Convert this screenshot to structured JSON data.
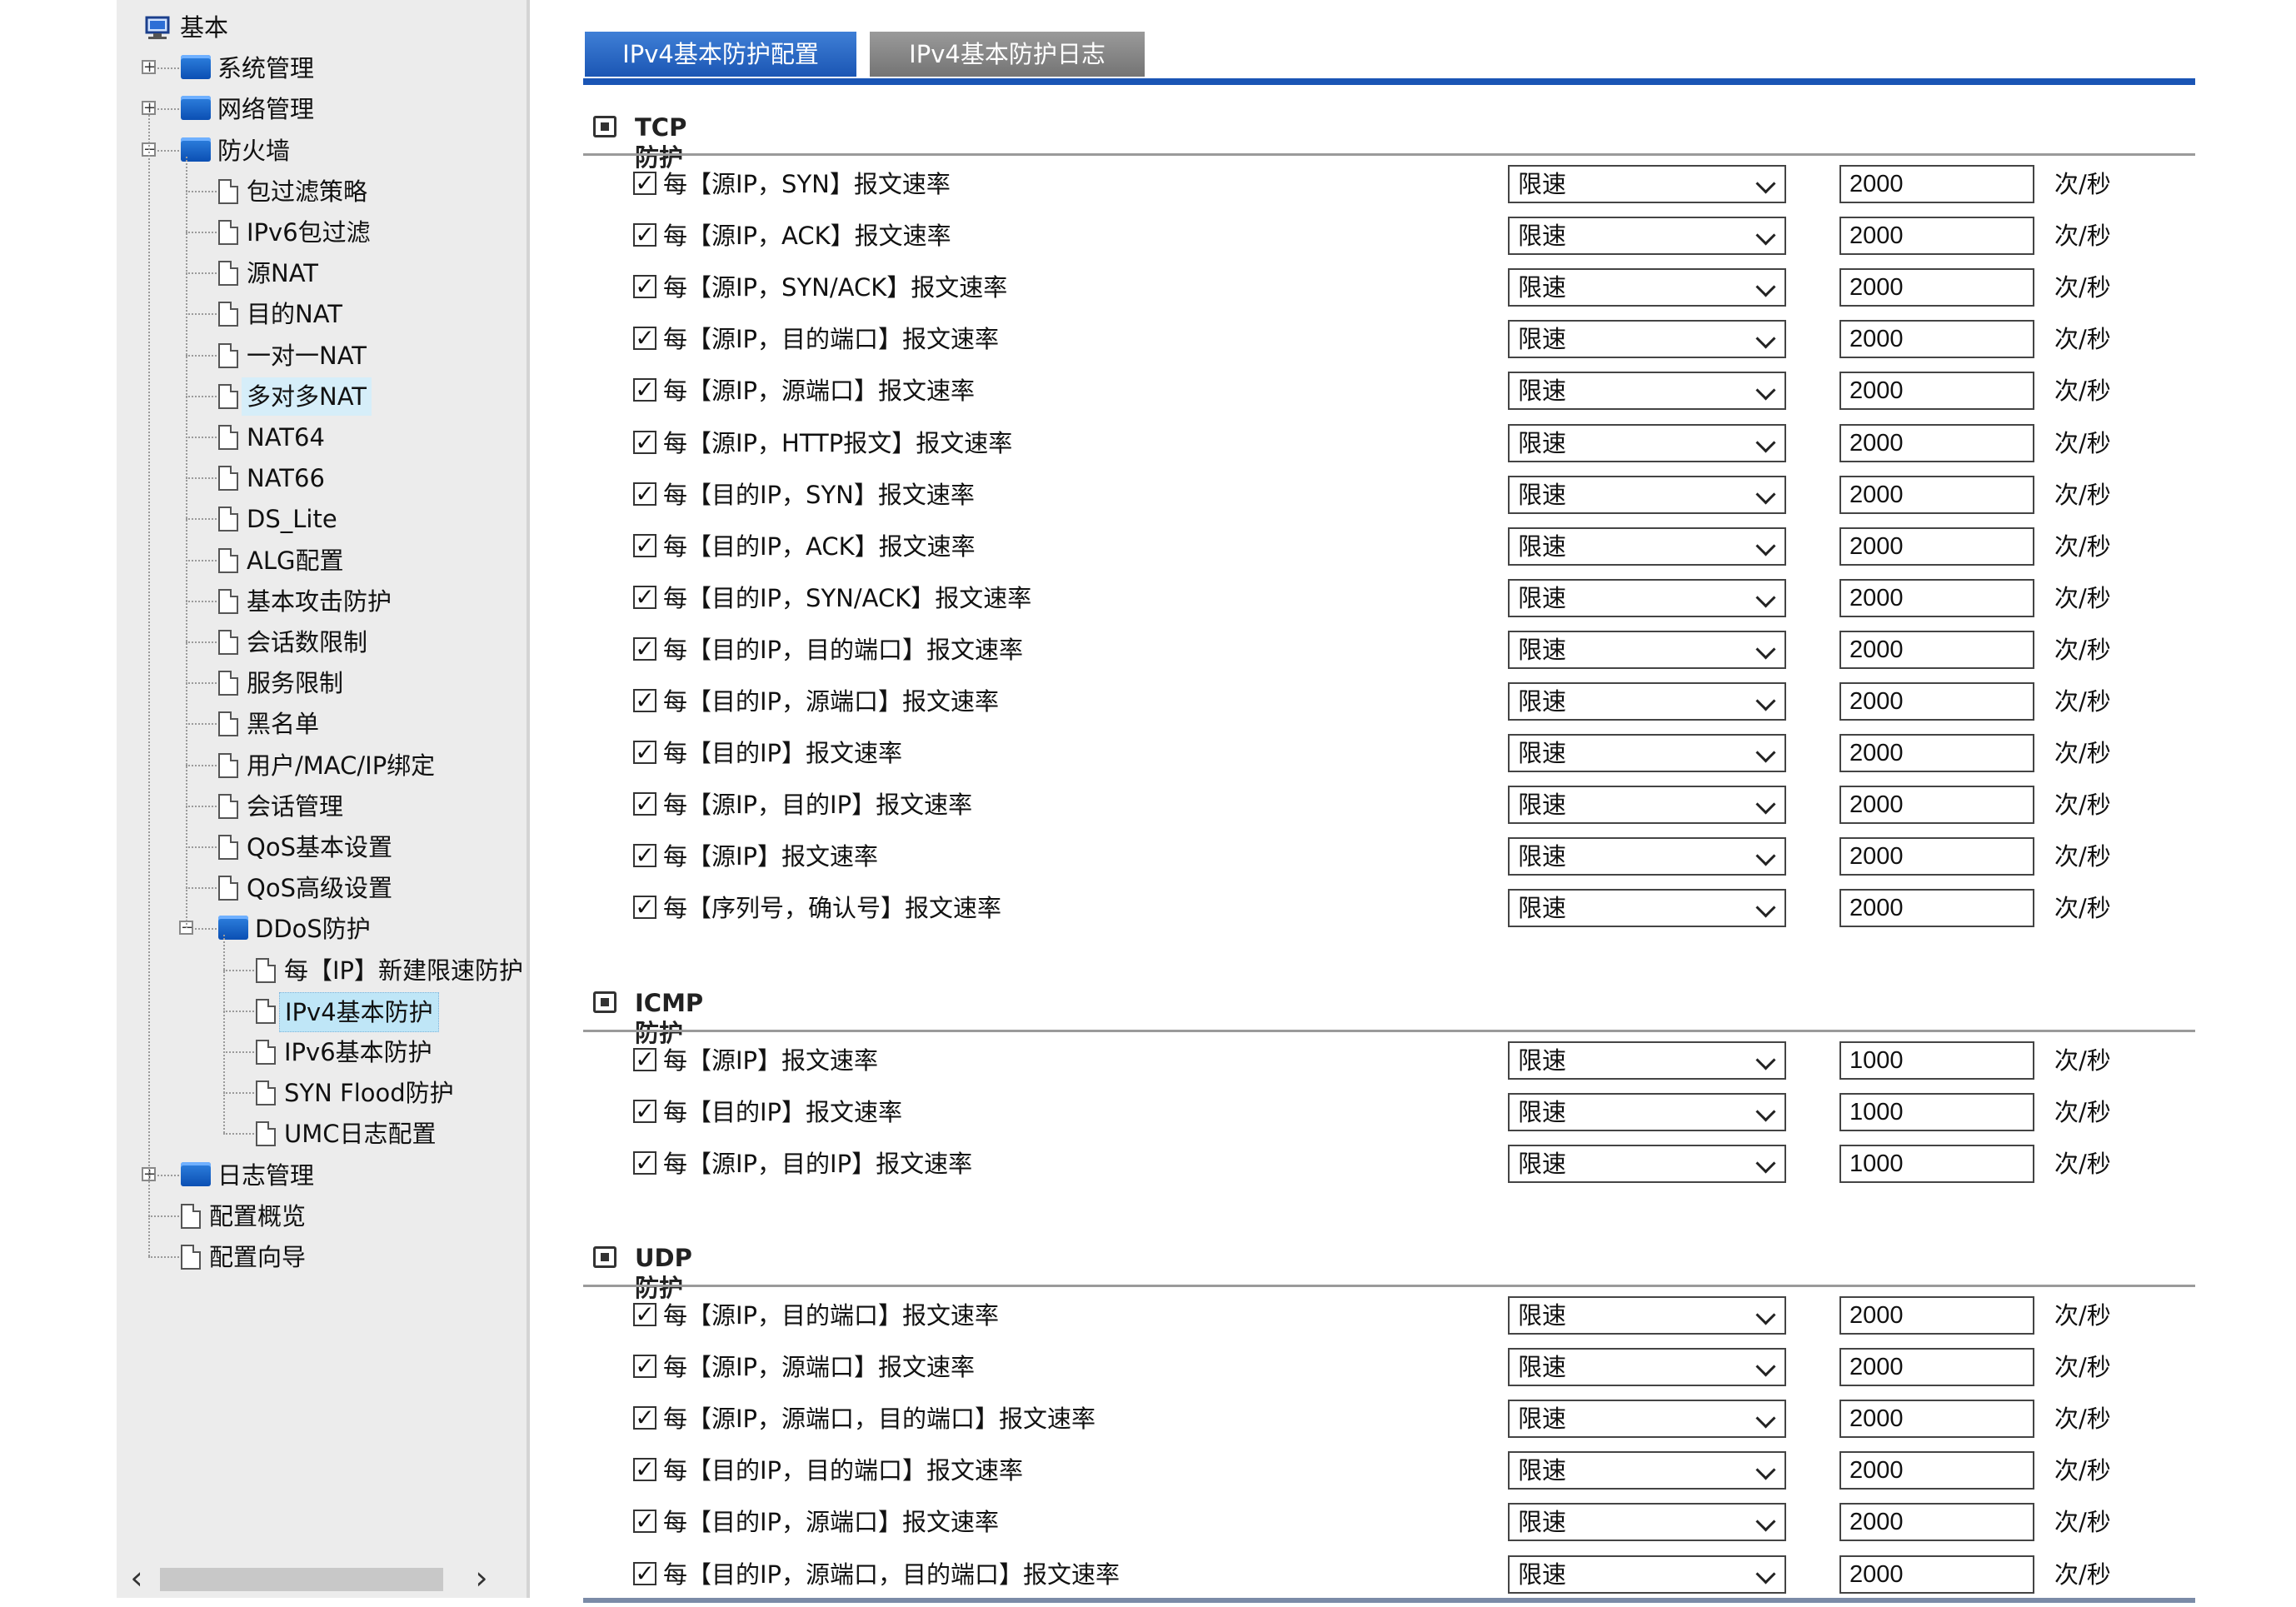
{
  "sidebar": {
    "items": [
      {
        "label": "基本",
        "level": 0,
        "icon": "computer-icon",
        "expander": ""
      },
      {
        "label": "系统管理",
        "level": 1,
        "icon": "folder-icon",
        "expander": "+"
      },
      {
        "label": "网络管理",
        "level": 1,
        "icon": "folder-icon",
        "expander": "+"
      },
      {
        "label": "防火墙",
        "level": 1,
        "icon": "folder-open-icon",
        "expander": "−"
      },
      {
        "label": "包过滤策略",
        "level": 2,
        "icon": "page-icon",
        "expander": ""
      },
      {
        "label": "IPv6包过滤",
        "level": 2,
        "icon": "page-icon",
        "expander": ""
      },
      {
        "label": "源NAT",
        "level": 2,
        "icon": "page-icon",
        "expander": ""
      },
      {
        "label": "目的NAT",
        "level": 2,
        "icon": "page-icon",
        "expander": ""
      },
      {
        "label": "一对一NAT",
        "level": 2,
        "icon": "page-icon",
        "expander": ""
      },
      {
        "label": "多对多NAT",
        "level": 2,
        "icon": "page-icon",
        "expander": "",
        "state": "hovered"
      },
      {
        "label": "NAT64",
        "level": 2,
        "icon": "page-icon",
        "expander": ""
      },
      {
        "label": "NAT66",
        "level": 2,
        "icon": "page-icon",
        "expander": ""
      },
      {
        "label": "DS_Lite",
        "level": 2,
        "icon": "page-icon",
        "expander": ""
      },
      {
        "label": "ALG配置",
        "level": 2,
        "icon": "page-icon",
        "expander": ""
      },
      {
        "label": "基本攻击防护",
        "level": 2,
        "icon": "page-icon",
        "expander": ""
      },
      {
        "label": "会话数限制",
        "level": 2,
        "icon": "page-icon",
        "expander": ""
      },
      {
        "label": "服务限制",
        "level": 2,
        "icon": "page-icon",
        "expander": ""
      },
      {
        "label": "黑名单",
        "level": 2,
        "icon": "page-icon",
        "expander": ""
      },
      {
        "label": "用户/MAC/IP绑定",
        "level": 2,
        "icon": "page-icon",
        "expander": ""
      },
      {
        "label": "会话管理",
        "level": 2,
        "icon": "page-icon",
        "expander": ""
      },
      {
        "label": "QoS基本设置",
        "level": 2,
        "icon": "page-icon",
        "expander": ""
      },
      {
        "label": "QoS高级设置",
        "level": 2,
        "icon": "page-icon",
        "expander": ""
      },
      {
        "label": "DDoS防护",
        "level": 2,
        "icon": "folder-open-icon",
        "expander": "−"
      },
      {
        "label": "每【IP】新建限速防护",
        "level": 3,
        "icon": "page-icon",
        "expander": ""
      },
      {
        "label": "IPv4基本防护",
        "level": 3,
        "icon": "page-icon",
        "expander": "",
        "state": "selected"
      },
      {
        "label": "IPv6基本防护",
        "level": 3,
        "icon": "page-icon",
        "expander": ""
      },
      {
        "label": "SYN Flood防护",
        "level": 3,
        "icon": "page-icon",
        "expander": ""
      },
      {
        "label": "UMC日志配置",
        "level": 3,
        "icon": "page-icon",
        "expander": ""
      },
      {
        "label": "日志管理",
        "level": 1,
        "icon": "folder-icon",
        "expander": "+"
      },
      {
        "label": "配置概览",
        "level": 1,
        "icon": "page-icon",
        "expander": ""
      },
      {
        "label": "配置向导",
        "level": 1,
        "icon": "page-icon",
        "expander": ""
      }
    ],
    "scroll_left": "‹",
    "scroll_right": "›"
  },
  "tabs": [
    {
      "label": "IPv4基本防护配置",
      "active": true
    },
    {
      "label": "IPv4基本防护日志",
      "active": false
    }
  ],
  "sections": [
    {
      "title": "TCP防护",
      "rows": [
        {
          "label": "每【源IP，SYN】报文速率",
          "checked": true,
          "mode": "限速",
          "value": "2000",
          "unit": "次/秒"
        },
        {
          "label": "每【源IP，ACK】报文速率",
          "checked": true,
          "mode": "限速",
          "value": "2000",
          "unit": "次/秒"
        },
        {
          "label": "每【源IP，SYN/ACK】报文速率",
          "checked": true,
          "mode": "限速",
          "value": "2000",
          "unit": "次/秒"
        },
        {
          "label": "每【源IP，目的端口】报文速率",
          "checked": true,
          "mode": "限速",
          "value": "2000",
          "unit": "次/秒"
        },
        {
          "label": "每【源IP，源端口】报文速率",
          "checked": true,
          "mode": "限速",
          "value": "2000",
          "unit": "次/秒"
        },
        {
          "label": "每【源IP，HTTP报文】报文速率",
          "checked": true,
          "mode": "限速",
          "value": "2000",
          "unit": "次/秒"
        },
        {
          "label": "每【目的IP，SYN】报文速率",
          "checked": true,
          "mode": "限速",
          "value": "2000",
          "unit": "次/秒"
        },
        {
          "label": "每【目的IP，ACK】报文速率",
          "checked": true,
          "mode": "限速",
          "value": "2000",
          "unit": "次/秒"
        },
        {
          "label": "每【目的IP，SYN/ACK】报文速率",
          "checked": true,
          "mode": "限速",
          "value": "2000",
          "unit": "次/秒"
        },
        {
          "label": "每【目的IP，目的端口】报文速率",
          "checked": true,
          "mode": "限速",
          "value": "2000",
          "unit": "次/秒"
        },
        {
          "label": "每【目的IP，源端口】报文速率",
          "checked": true,
          "mode": "限速",
          "value": "2000",
          "unit": "次/秒"
        },
        {
          "label": "每【目的IP】报文速率",
          "checked": true,
          "mode": "限速",
          "value": "2000",
          "unit": "次/秒"
        },
        {
          "label": "每【源IP，目的IP】报文速率",
          "checked": true,
          "mode": "限速",
          "value": "2000",
          "unit": "次/秒"
        },
        {
          "label": "每【源IP】报文速率",
          "checked": true,
          "mode": "限速",
          "value": "2000",
          "unit": "次/秒"
        },
        {
          "label": "每【序列号，确认号】报文速率",
          "checked": true,
          "mode": "限速",
          "value": "2000",
          "unit": "次/秒"
        }
      ]
    },
    {
      "title": "ICMP防护",
      "rows": [
        {
          "label": "每【源IP】报文速率",
          "checked": true,
          "mode": "限速",
          "value": "1000",
          "unit": "次/秒"
        },
        {
          "label": "每【目的IP】报文速率",
          "checked": true,
          "mode": "限速",
          "value": "1000",
          "unit": "次/秒"
        },
        {
          "label": "每【源IP，目的IP】报文速率",
          "checked": true,
          "mode": "限速",
          "value": "1000",
          "unit": "次/秒"
        }
      ]
    },
    {
      "title": "UDP防护",
      "rows": [
        {
          "label": "每【源IP，目的端口】报文速率",
          "checked": true,
          "mode": "限速",
          "value": "2000",
          "unit": "次/秒"
        },
        {
          "label": "每【源IP，源端口】报文速率",
          "checked": true,
          "mode": "限速",
          "value": "2000",
          "unit": "次/秒"
        },
        {
          "label": "每【源IP，源端口，目的端口】报文速率",
          "checked": true,
          "mode": "限速",
          "value": "2000",
          "unit": "次/秒"
        },
        {
          "label": "每【目的IP，目的端口】报文速率",
          "checked": true,
          "mode": "限速",
          "value": "2000",
          "unit": "次/秒"
        },
        {
          "label": "每【目的IP，源端口】报文速率",
          "checked": true,
          "mode": "限速",
          "value": "2000",
          "unit": "次/秒"
        },
        {
          "label": "每【目的IP，源端口，目的端口】报文速率",
          "checked": true,
          "mode": "限速",
          "value": "2000",
          "unit": "次/秒"
        }
      ]
    }
  ],
  "colors": {
    "tab_active": "#1b56b4",
    "tab_inactive": "#808080",
    "tab_underline": "#1a55b5",
    "folder": "#0b4fb3",
    "selected": "#bfe6f7"
  }
}
